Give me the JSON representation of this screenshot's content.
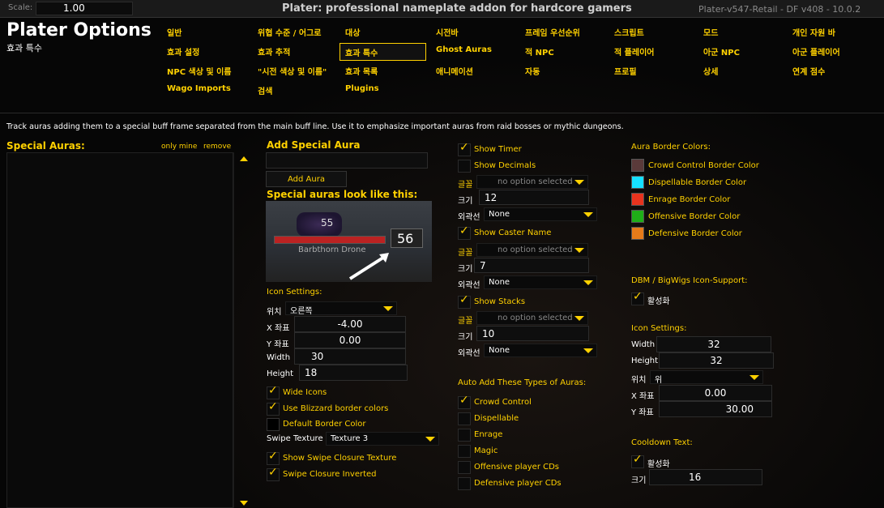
{
  "topbar": {
    "scale_label": "Scale:",
    "scale_value": "1.00",
    "title": "Plater: professional nameplate addon for hardcore gamers",
    "version": "Plater-v547-Retail - DF v408 - 10.0.2"
  },
  "header": {
    "heading": "Plater Options",
    "subheading": "효과 특수"
  },
  "tabs": [
    "일반",
    "위협 수준 / 어그로",
    "대상",
    "시전바",
    "프레임 우선순위",
    "스크립트",
    "모드",
    "개인 자원 바",
    "효과 설정",
    "효과 추적",
    "효과 특수",
    "Ghost Auras",
    "적 NPC",
    "적 플레이어",
    "아군 NPC",
    "아군 플레이어",
    "NPC 색상 및 이름",
    "\"시전 색상 및 이름\"",
    "효과 목록",
    "애니메이션",
    "자동",
    "프로필",
    "상세",
    "연계 점수",
    "Wago Imports",
    "검색",
    "Plugins"
  ],
  "description": "Track auras adding them to a special buff frame separated from the main buff line. Use it to emphasize important auras from raid bosses or mythic dungeons.",
  "left": {
    "title": "Special Auras:",
    "link1": "only mine",
    "link2": "remove"
  },
  "add": {
    "title": "Add Special Aura",
    "button": "Add Aura",
    "preview_title": "Special auras look like this:",
    "preview_level": "55",
    "preview_number": "56",
    "preview_name": "Barbthorn Drone"
  },
  "icon_settings": {
    "title": "Icon Settings:",
    "anchor_label": "위치",
    "anchor_value": "오른쪽",
    "x_label": "X 좌표",
    "x_value": "-4.00",
    "y_label": "Y 좌표",
    "y_value": "0.00",
    "width_label": "Width",
    "width_value": "30",
    "height_label": "Height",
    "height_value": "18",
    "wide_icons": "Wide Icons",
    "blizzard_border": "Use Blizzard border colors",
    "default_border": "Default Border Color",
    "swipe_label": "Swipe Texture",
    "swipe_value": "Texture 3",
    "swipe_closure": "Show Swipe Closure Texture",
    "swipe_inverted": "Swipe Closure Inverted"
  },
  "timer": {
    "show_timer": "Show Timer",
    "show_decimals": "Show Decimals",
    "font_label": "글꼴",
    "font_value": "no option selected",
    "size_label": "크기",
    "size_value": "12",
    "outline_label": "외곽선",
    "outline_value": "None"
  },
  "caster": {
    "show_caster": "Show Caster Name",
    "font_label": "글꼴",
    "font_value": "no option selected",
    "size_label": "크기",
    "size_value": "7",
    "outline_label": "외곽선",
    "outline_value": "None"
  },
  "stacks": {
    "show_stacks": "Show Stacks",
    "font_label": "글꼴",
    "font_value": "no option selected",
    "size_label": "크기",
    "size_value": "10",
    "outline_label": "외곽선",
    "outline_value": "None"
  },
  "auto_add": {
    "title": "Auto Add These Types of Auras:",
    "items": [
      "Crowd Control",
      "Dispellable",
      "Enrage",
      "Magic",
      "Offensive player CDs",
      "Defensive player CDs"
    ]
  },
  "border_colors": {
    "title": "Aura Border Colors:",
    "items": [
      {
        "label": "Crowd Control Border Color",
        "color": "#5a3a3a"
      },
      {
        "label": "Dispellable Border Color",
        "color": "#16e0ff"
      },
      {
        "label": "Enrage Border Color",
        "color": "#e8331e"
      },
      {
        "label": "Offensive Border Color",
        "color": "#1fae18"
      },
      {
        "label": "Defensive Border Color",
        "color": "#e57b1a"
      }
    ]
  },
  "dbm": {
    "title": "DBM / BigWigs Icon-Support:",
    "enabled": "활성화"
  },
  "dbm_icon": {
    "title": "Icon Settings:",
    "width_label": "Width",
    "width_value": "32",
    "height_label": "Height",
    "height_value": "32",
    "anchor_label": "위치",
    "anchor_value": "위",
    "x_label": "X 좌표",
    "x_value": "0.00",
    "y_label": "Y 좌표",
    "y_value": "30.00"
  },
  "cooldown": {
    "title": "Cooldown Text:",
    "enabled": "활성화",
    "size_label": "크기",
    "size_value": "16"
  }
}
